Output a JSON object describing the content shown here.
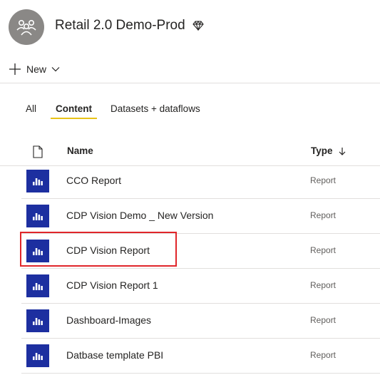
{
  "workspace": {
    "title": "Retail 2.0 Demo-Prod"
  },
  "toolbar": {
    "new_label": "New"
  },
  "tabs": [
    {
      "label": "All"
    },
    {
      "label": "Content"
    },
    {
      "label": "Datasets + dataflows"
    }
  ],
  "table": {
    "columns": {
      "name": "Name",
      "type": "Type"
    },
    "rows": [
      {
        "name": "CCO Report",
        "type": "Report"
      },
      {
        "name": "CDP Vision Demo _ New Version",
        "type": "Report"
      },
      {
        "name": "CDP Vision Report",
        "type": "Report"
      },
      {
        "name": "CDP Vision Report 1",
        "type": "Report"
      },
      {
        "name": "Dashboard-Images",
        "type": "Report"
      },
      {
        "name": "Datbase template PBI",
        "type": "Report"
      }
    ]
  },
  "colors": {
    "accent_underline": "#e8c217",
    "report_icon_bg": "#1d2fa0",
    "highlight_border": "#e0262a"
  },
  "icons": [
    "workspace-group-icon",
    "premium-diamond-icon",
    "plus-icon",
    "chevron-down-icon",
    "document-icon",
    "sort-down-arrow-icon",
    "report-bar-chart-icon"
  ]
}
